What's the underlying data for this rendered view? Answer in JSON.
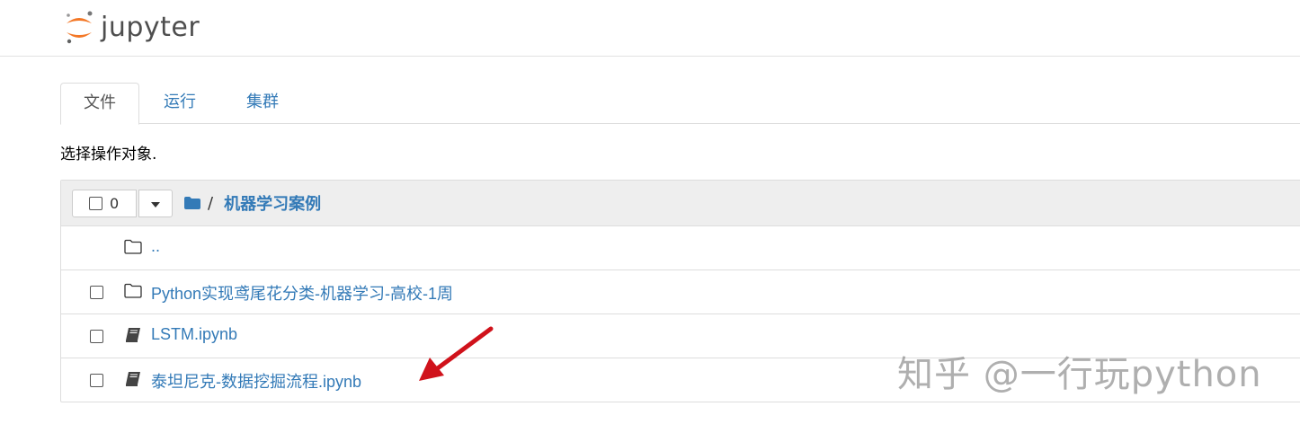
{
  "app": {
    "logo_text": "jupyter"
  },
  "tabs": [
    {
      "label": "文件",
      "active": true
    },
    {
      "label": "运行",
      "active": false
    },
    {
      "label": "集群",
      "active": false
    }
  ],
  "instructions": "选择操作对象.",
  "toolbar": {
    "selected_count": "0",
    "breadcrumb_separator": "/",
    "breadcrumb_current": "机器学习案例"
  },
  "files": [
    {
      "name": "..",
      "type": "parent-folder",
      "selectable": false
    },
    {
      "name": "Python实现鸢尾花分类-机器学习-高校-1周",
      "type": "folder",
      "selectable": true
    },
    {
      "name": "LSTM.ipynb",
      "type": "notebook",
      "selectable": true
    },
    {
      "name": "泰坦尼克-数据挖掘流程.ipynb",
      "type": "notebook",
      "selectable": true
    }
  ],
  "watermark": "知乎 @一行玩python",
  "colors": {
    "link": "#337ab7",
    "accent_logo": "#f37726",
    "arrow": "#d0121b"
  }
}
